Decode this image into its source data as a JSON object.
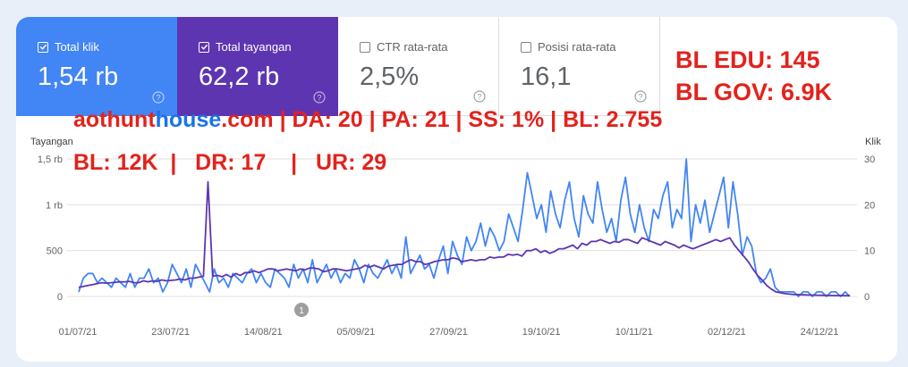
{
  "metrics": [
    {
      "label": "Total klik",
      "value": "1,54 rb",
      "checked": true
    },
    {
      "label": "Total tayangan",
      "value": "62,2 rb",
      "checked": true
    },
    {
      "label": "CTR rata-rata",
      "value": "2,5%",
      "checked": false
    },
    {
      "label": "Posisi rata-rata",
      "value": "16,1",
      "checked": false
    }
  ],
  "backlinks": {
    "edu": "BL EDU: 145",
    "gov": "BL GOV: 6.9K"
  },
  "overlay": {
    "domain_part1": "aothunt",
    "domain_part2": "house",
    "domain_part3": ".com",
    "stats_line1": " | DA: 20 | PA: 21 | SS: 1% | BL: 2.755",
    "stats_line2": "BL: 12K  |   DR: 17    |   UR: 29"
  },
  "colors": {
    "clicks": "#4285f4",
    "impressions": "#5e35b1",
    "annotation": "#e3221c"
  },
  "chart_data": {
    "type": "line",
    "left_axis": {
      "title": "Tayangan",
      "ticks": [
        "1,5 rb",
        "1 rb",
        "500",
        "0"
      ],
      "ylim": [
        0,
        1500
      ]
    },
    "right_axis": {
      "title": "Klik",
      "ticks": [
        "30",
        "20",
        "10",
        "0"
      ],
      "ylim": [
        0,
        30
      ]
    },
    "x_ticks": [
      "01/07/21",
      "23/07/21",
      "14/08/21",
      "05/09/21",
      "27/09/21",
      "19/10/21",
      "10/11/21",
      "02/12/21",
      "24/12/21"
    ],
    "annotation_marker": "1",
    "series": [
      {
        "axis": "right",
        "color": "#4285f4",
        "values": [
          1,
          4,
          5,
          5,
          3,
          4,
          3,
          2,
          4,
          3,
          2,
          5,
          2,
          4,
          4,
          6,
          3,
          4,
          1,
          3,
          7,
          5,
          3,
          6,
          2,
          7,
          5,
          3,
          1,
          6,
          3,
          4,
          2,
          5,
          4,
          3,
          5,
          6,
          3,
          5,
          3,
          2,
          6,
          5,
          4,
          2,
          7,
          4,
          6,
          3,
          8,
          3,
          5,
          7,
          4,
          6,
          3,
          5,
          4,
          8,
          6,
          3,
          7,
          5,
          4,
          6,
          8,
          5,
          7,
          4,
          13,
          5,
          7,
          9,
          6,
          7,
          4,
          8,
          11,
          5,
          12,
          9,
          7,
          13,
          10,
          12,
          16,
          11,
          15,
          13,
          10,
          12,
          18,
          15,
          12,
          19,
          27,
          22,
          17,
          20,
          14,
          23,
          18,
          15,
          21,
          25,
          17,
          13,
          22,
          18,
          16,
          25,
          19,
          14,
          17,
          12,
          21,
          26,
          18,
          14,
          20,
          15,
          12,
          19,
          17,
          22,
          25,
          15,
          19,
          17,
          30,
          12,
          20,
          16,
          21,
          14,
          18,
          22,
          26,
          15,
          25,
          18,
          9,
          13,
          11,
          5,
          3,
          4,
          6,
          2,
          1,
          1,
          1,
          1,
          0,
          1,
          1,
          0,
          1,
          1,
          0,
          1,
          1,
          0,
          1,
          0
        ],
        "values_note": "approximate daily clicks"
      },
      {
        "axis": "left",
        "color": "#5e35b1",
        "values": [
          100,
          110,
          120,
          130,
          140,
          150,
          145,
          150,
          155,
          160,
          160,
          165,
          150,
          150,
          170,
          160,
          170,
          165,
          180,
          170,
          175,
          180,
          190,
          180,
          200,
          200,
          210,
          220,
          1250,
          220,
          230,
          215,
          240,
          210,
          250,
          230,
          260,
          260,
          280,
          260,
          280,
          300,
          300,
          280,
          290,
          300,
          290,
          280,
          300,
          290,
          310,
          310,
          300,
          270,
          280,
          300,
          300,
          290,
          280,
          290,
          300,
          310,
          340,
          320,
          340,
          320,
          300,
          330,
          340,
          350,
          350,
          380,
          400,
          380,
          380,
          350,
          360,
          380,
          390,
          400,
          400,
          420,
          410,
          380,
          390,
          400,
          390,
          400,
          400,
          430,
          420,
          430,
          430,
          460,
          450,
          460,
          440,
          500,
          500,
          520,
          480,
          500,
          470,
          490,
          520,
          520,
          540,
          560,
          520,
          580,
          560,
          600,
          600,
          620,
          600,
          580,
          600,
          590,
          620,
          620,
          600,
          580,
          640,
          620,
          600,
          580,
          560,
          600,
          580,
          560,
          530,
          560,
          540,
          520,
          540,
          560,
          580,
          600,
          620,
          600,
          620,
          640,
          560,
          500,
          440,
          380,
          300,
          230,
          180,
          120,
          80,
          50,
          40,
          30,
          25,
          20,
          20,
          18,
          16,
          15,
          14,
          13,
          12,
          11,
          10,
          10,
          9,
          8
        ]
      }
    ]
  }
}
